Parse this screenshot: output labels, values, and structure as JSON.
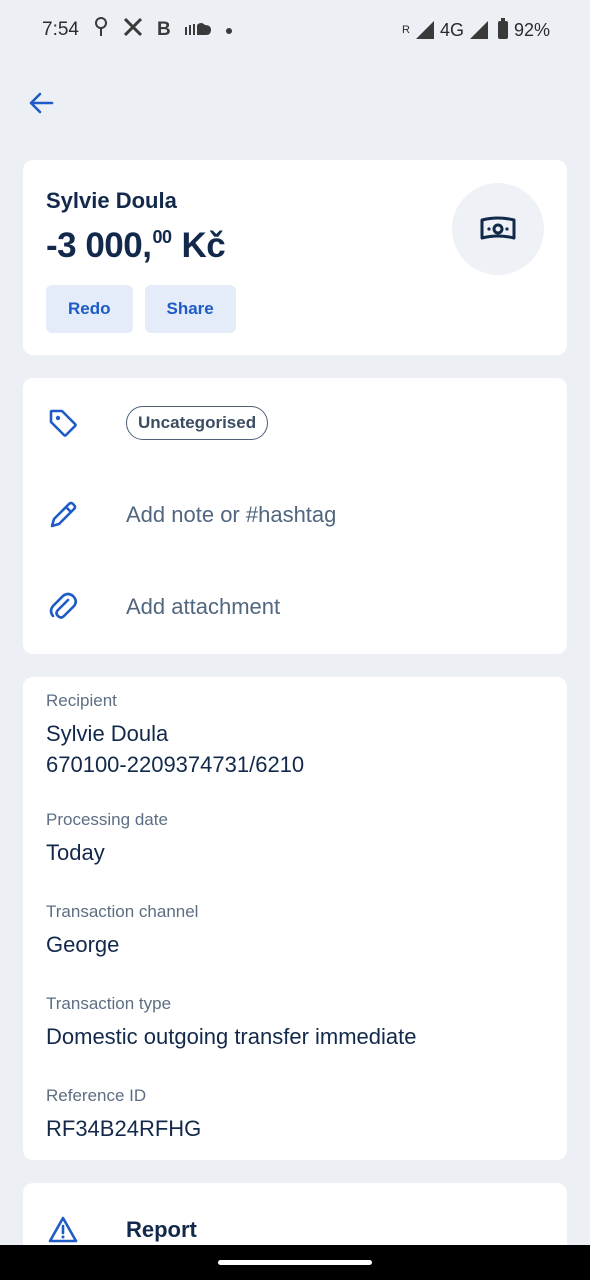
{
  "status_bar": {
    "time": "7:54",
    "icons_left": [
      "location-icon",
      "x-logo-icon",
      "b-icon",
      "soundcloud-icon",
      "dot-icon"
    ],
    "network": "4G",
    "roaming": "R",
    "battery": "92%"
  },
  "header": {
    "payee": "Sylvie Doula",
    "amount_main": "-3 000,",
    "amount_cents": "00",
    "currency": "Kč",
    "buttons": {
      "redo": "Redo",
      "share": "Share"
    },
    "icon": "cash-icon"
  },
  "actions": {
    "category": "Uncategorised",
    "note_placeholder": "Add note or #hashtag",
    "attachment": "Add attachment"
  },
  "details": [
    {
      "label": "Recipient",
      "value": "Sylvie Doula",
      "value2": "670100-2209374731/6210"
    },
    {
      "label": "Processing date",
      "value": "Today"
    },
    {
      "label": "Transaction channel",
      "value": "George"
    },
    {
      "label": "Transaction type",
      "value": "Domestic outgoing transfer immediate"
    },
    {
      "label": "Reference ID",
      "value": "RF34B24RFHG"
    }
  ],
  "report": {
    "label": "Report"
  },
  "colors": {
    "background": "#ECEFF4",
    "accent": "#1E5BC6",
    "text": "#13294B"
  }
}
